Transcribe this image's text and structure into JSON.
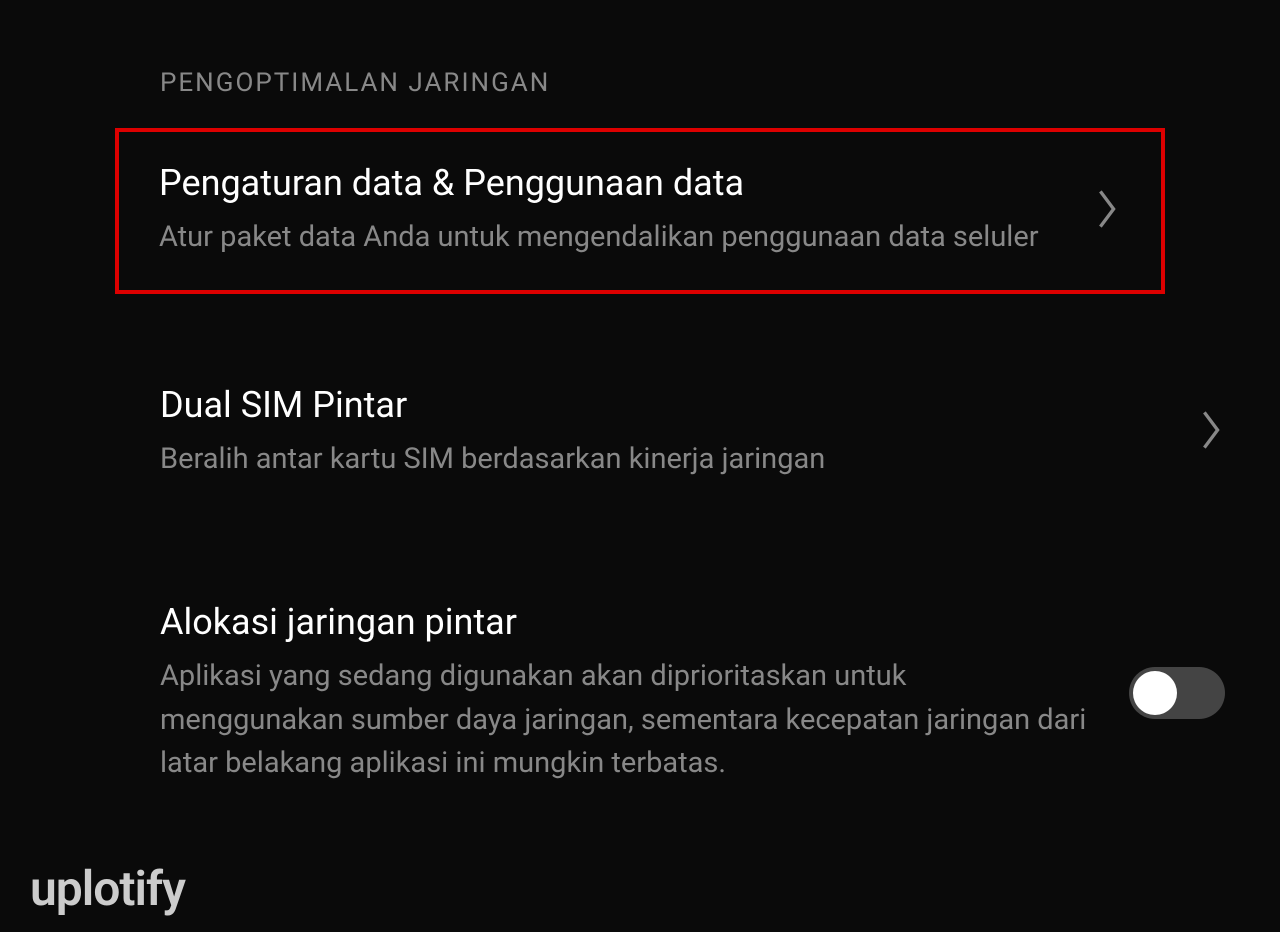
{
  "section": {
    "header": "PENGOPTIMALAN JARINGAN"
  },
  "settings": {
    "data_usage": {
      "title": "Pengaturan data & Penggunaan data",
      "description": "Atur paket data Anda untuk mengendalikan penggunaan data seluler"
    },
    "dual_sim": {
      "title": "Dual SIM Pintar",
      "description": "Beralih antar kartu SIM berdasarkan kinerja jaringan"
    },
    "smart_allocation": {
      "title": "Alokasi jaringan pintar",
      "description": "Aplikasi yang sedang digunakan akan diprioritaskan untuk menggunakan sumber daya jaringan, sementara kecepatan jaringan dari latar belakang aplikasi ini mungkin terbatas.",
      "toggle_state": "off"
    }
  },
  "watermark": "uplotify"
}
